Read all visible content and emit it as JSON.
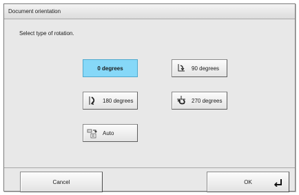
{
  "window": {
    "title": "Document orientation"
  },
  "prompt": "Select type of rotation.",
  "options": {
    "deg0": {
      "label": "0 degrees",
      "selected": true
    },
    "deg90": {
      "label": "90 degrees",
      "icon": "rotate-90-icon"
    },
    "deg180": {
      "label": "180 degrees",
      "icon": "rotate-180-icon"
    },
    "deg270": {
      "label": "270 degrees",
      "icon": "rotate-270-icon"
    },
    "auto": {
      "label": "Auto",
      "icon": "auto-rotate-icon"
    }
  },
  "footer": {
    "cancel_label": "Cancel",
    "ok_label": "OK",
    "ok_icon": "enter-key-icon"
  },
  "colors": {
    "selected_bg": "#86d8f8",
    "dialog_bg": "#e8e8e8"
  }
}
